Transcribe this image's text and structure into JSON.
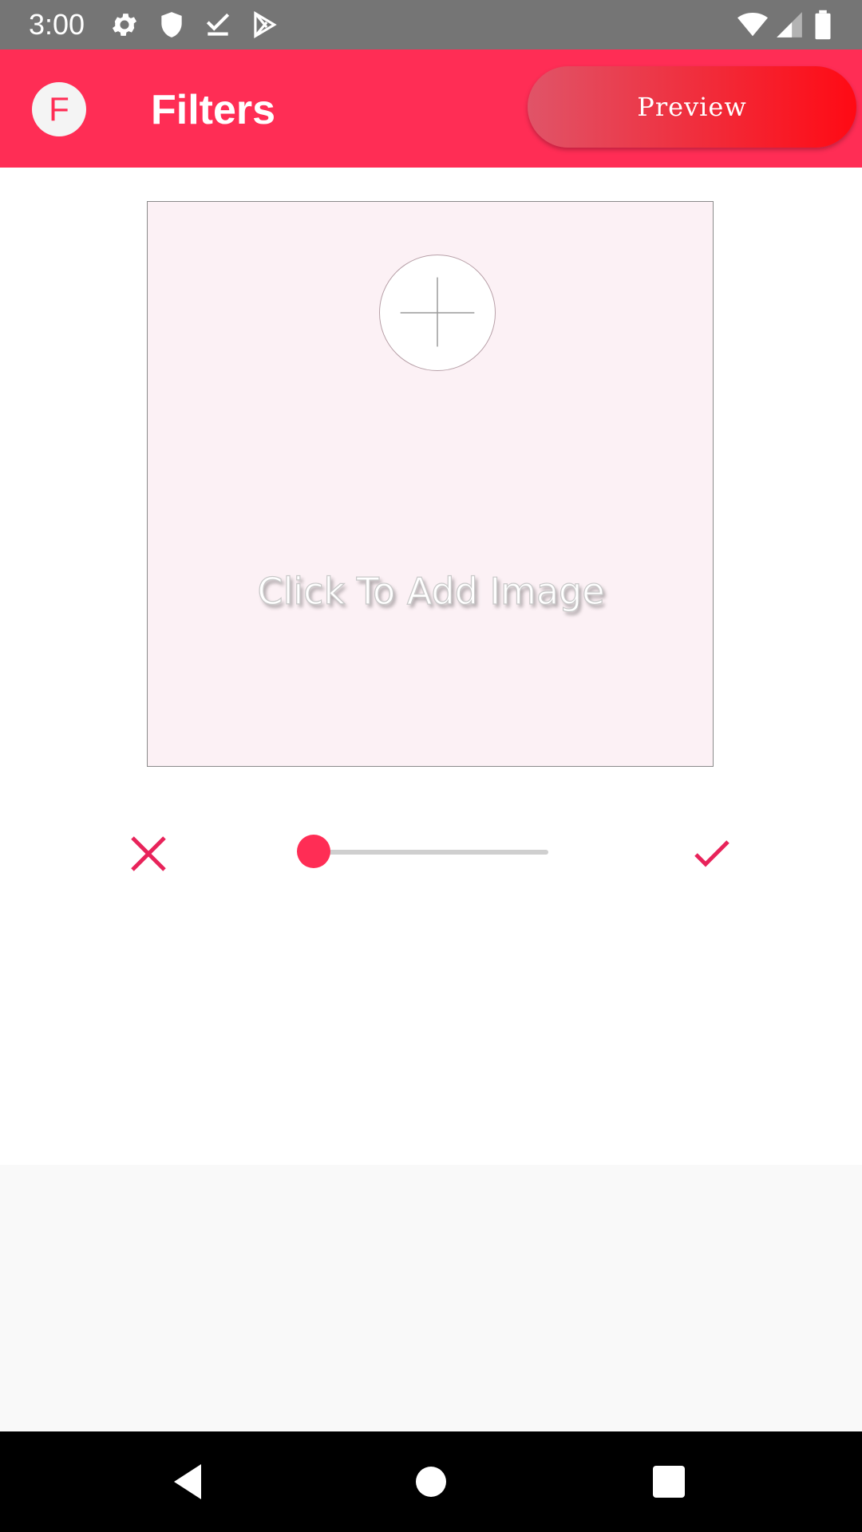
{
  "status_bar": {
    "time": "3:00",
    "icons_left": [
      "gear-icon",
      "shield-icon",
      "download-check-icon",
      "play-store-icon"
    ],
    "icons_right": [
      "wifi-icon",
      "signal-icon",
      "battery-icon"
    ]
  },
  "app_bar": {
    "avatar_letter": "F",
    "title": "Filters",
    "preview_label": "Preview"
  },
  "image_area": {
    "add_label": "Click To Add Image",
    "add_icon": "plus-icon"
  },
  "controls": {
    "cancel_icon": "close-icon",
    "confirm_icon": "check-icon",
    "slider_value": 0
  },
  "nav_bar": {
    "icons": [
      "back-icon",
      "home-icon",
      "recents-icon"
    ]
  },
  "colors": {
    "accent": "#ff2d55",
    "status_bar": "#757575",
    "image_bg": "#fcf1f5",
    "nav_bar": "#000000"
  }
}
